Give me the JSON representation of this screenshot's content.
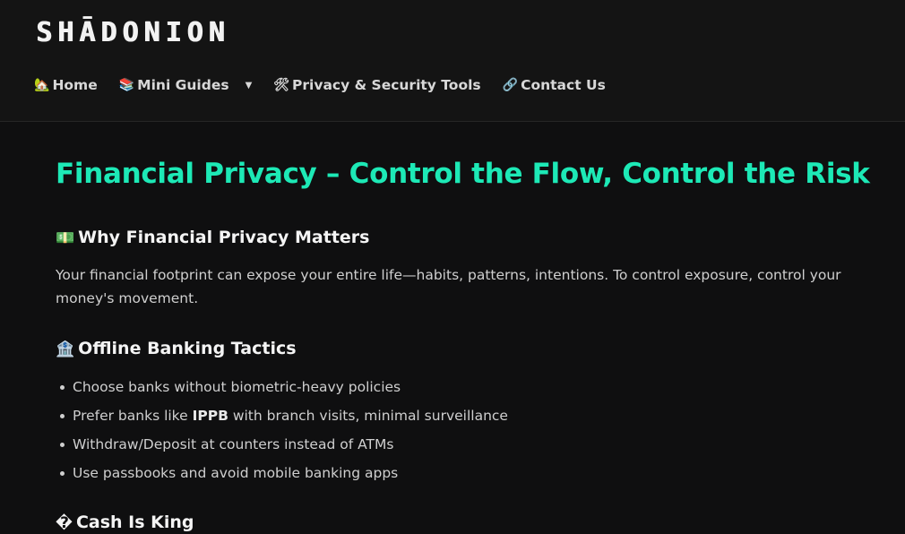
{
  "site": {
    "logo_text": "SHĀDONION"
  },
  "nav": {
    "items": [
      {
        "icon": "🏡",
        "icon_name": "house-icon",
        "label": "Home"
      },
      {
        "icon": "📚",
        "icon_name": "books-icon",
        "label": "Mini Guides",
        "has_dropdown": true,
        "caret": "▼"
      },
      {
        "icon": "🛠",
        "icon_name": "tools-icon",
        "label": "Privacy & Security Tools"
      },
      {
        "icon": "🔗",
        "icon_name": "link-icon",
        "label": "Contact Us"
      }
    ]
  },
  "article": {
    "title": "Financial Privacy – Control the Flow, Control the Risk",
    "sections": [
      {
        "icon": "💵",
        "icon_name": "money-icon",
        "heading": "Why Financial Privacy Matters",
        "paragraph": "Your financial footprint can expose your entire life—habits, patterns, intentions. To control exposure, control your money's movement."
      },
      {
        "icon": "🏦",
        "icon_name": "bank-icon",
        "heading": "Offline Banking Tactics",
        "bullets": [
          {
            "text": "Choose banks without biometric-heavy policies"
          },
          {
            "prefix": "Prefer banks like ",
            "bold": "IPPB",
            "suffix": " with branch visits, minimal surveillance"
          },
          {
            "text": "Withdraw/Deposit at counters instead of ATMs"
          },
          {
            "text": "Use passbooks and avoid mobile banking apps"
          }
        ]
      },
      {
        "icon": "�",
        "icon_name": "unknown-glyph-icon",
        "heading": "Cash Is King"
      }
    ]
  },
  "colors": {
    "accent": "#1de9b6",
    "background": "#0f0f10",
    "header_background": "#141414",
    "text": "#cfcfcf"
  }
}
